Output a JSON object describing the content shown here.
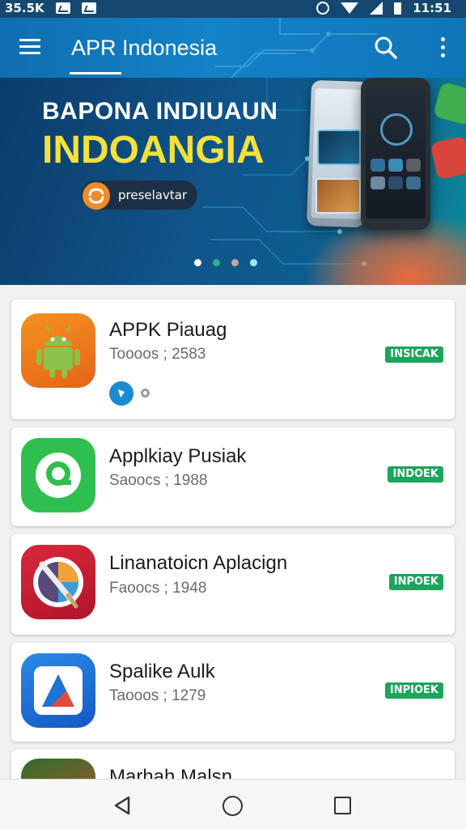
{
  "status_bar": {
    "left_text": "35.5K",
    "time": "11:51",
    "icons": [
      "image-notification-icon",
      "download-notification-icon",
      "alarm-icon",
      "wifi-icon",
      "signal-icon",
      "battery-icon"
    ]
  },
  "app_bar": {
    "title": "APR Indonesia",
    "icons": [
      "menu-icon",
      "search-icon",
      "more-vert-icon"
    ]
  },
  "banner": {
    "line1": "BAPONA INDIUAUN",
    "line2": "INDOANGIA",
    "cta_label": "preselavtar",
    "slide_dots": 4,
    "active_dot": 1,
    "colors": {
      "background": "#10548a",
      "headline_accent": "#f4e13c",
      "cta_icon": "#f08a2a"
    }
  },
  "apps": [
    {
      "name": "APPK Piauag",
      "meta": "Toooos ; 2583",
      "install_label": "INSICAK",
      "icon": "android-robot-icon",
      "icon_bg": "#f07a1e",
      "has_badges": true
    },
    {
      "name": "Applkiay Pusiak",
      "meta": "Saoocs ; 1988",
      "install_label": "INDOEK",
      "icon": "chat-bubble-icon",
      "icon_bg": "#2fbf4e",
      "has_badges": false
    },
    {
      "name": "Linanatoicn Aplacign",
      "meta": "Faoocs ; 1948",
      "install_label": "INPOEK",
      "icon": "paint-brush-icon",
      "icon_bg": "#c9222f",
      "has_badges": false
    },
    {
      "name": "Spalike Aulk",
      "meta": "Taooos ; 1279",
      "install_label": "INPIOEK",
      "icon": "triangle-a-icon",
      "icon_bg": "#1e73d8",
      "has_badges": false
    },
    {
      "name": "Marhah Malsn",
      "meta": "",
      "install_label": "",
      "icon": "partial-app-icon",
      "icon_bg": "#2c6f2a",
      "has_badges": false
    }
  ],
  "colors": {
    "accent": "#1482c8",
    "install_green": "#1aa65b"
  },
  "nav_bar": {
    "icons": [
      "back-icon",
      "home-icon",
      "recents-icon"
    ]
  }
}
